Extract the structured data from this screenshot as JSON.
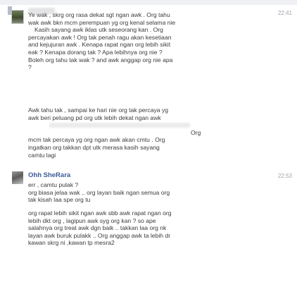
{
  "messages": [
    {
      "time": "22:41",
      "paragraphs": [
        [
          "Ye wak , skrg org rasa dekat sgt ngan awk . Org tahu",
          "wak awk bkn mcm perempuan yg org kenal selama nie",
          "Kasih sayang awk iklas utk seseorang kan . Org",
          "percayakan awk ! Org tak penah ragu akan kesetiaan",
          "and kejujuran awk . Kenapa rapat ngan org lebih sikit",
          "eak ? Kenapa dorang tak ? Apa lebihnya org nie ?",
          "Boleh org tahu tak wak ? and awk anggap org nie apa",
          "?"
        ],
        [
          "Awk tahu tak , sampai ke hari nie org tak percaya yg",
          "awk beri peluang pd org utk lebih dekat ngan awk",
          "",
          "Org",
          "mcm tak percaya yg org ngan awk akan cmtu . Org",
          "ingatkan org takkan dpt utk merasa kasih sayang",
          "camtu lagi"
        ]
      ]
    },
    {
      "sender": "Ohh SheRara",
      "time": "22:53",
      "paragraphs": [
        [
          "err , camtu pulak ?",
          "org biasa jelaa wak .. org layan baik ngan semua org",
          "tak kisah laa spe org tu"
        ],
        [
          "org rapat lebih sikit ngan awk sbb awk rapat ngan org",
          "lebih dkt org , lagipun awk syg org kan ? so ape",
          "salahnya org treat awk dgn baik .. takkan laa org nk",
          "layan awk buruk pulakk .. Org anggap awk ta lebih dr",
          "kawan skrg ni ,kawan tp mesra2"
        ]
      ]
    }
  ]
}
